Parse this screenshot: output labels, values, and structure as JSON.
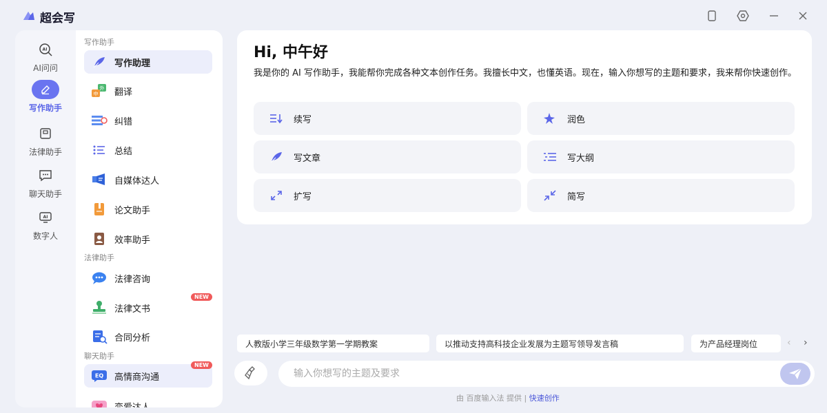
{
  "app": {
    "title": "超会写"
  },
  "rail": [
    {
      "label": "AI问问"
    },
    {
      "label": "写作助手"
    },
    {
      "label": "法律助手"
    },
    {
      "label": "聊天助手"
    },
    {
      "label": "数字人"
    }
  ],
  "menu": {
    "sections": [
      "写作助手",
      "法律助手",
      "聊天助手"
    ],
    "items": [
      {
        "label": "写作助理"
      },
      {
        "label": "翻译"
      },
      {
        "label": "纠错"
      },
      {
        "label": "总结"
      },
      {
        "label": "自媒体达人"
      },
      {
        "label": "论文助手"
      },
      {
        "label": "效率助手"
      },
      {
        "label": "法律咨询"
      },
      {
        "label": "法律文书",
        "badge": "NEW"
      },
      {
        "label": "合同分析"
      },
      {
        "label": "高情商沟通",
        "badge": "NEW"
      },
      {
        "label": "恋爱达人"
      }
    ]
  },
  "main": {
    "greeting": "Hi, 中午好",
    "intro": "我是你的 AI 写作助手，我能帮你完成各种文本创作任务。我擅长中文，也懂英语。现在，输入你想写的主题和要求，我来帮你快速创作。",
    "actions": [
      {
        "label": "续写"
      },
      {
        "label": "润色"
      },
      {
        "label": "写文章"
      },
      {
        "label": "写大纲"
      },
      {
        "label": "扩写"
      },
      {
        "label": "简写"
      }
    ]
  },
  "suggestions": [
    "人教版小学三年级数学第一学期教案",
    "以推动支持高科技企业发展为主题写领导发言稿",
    "为产品经理岗位"
  ],
  "input": {
    "placeholder": "输入你想写的主题及要求"
  },
  "footer": {
    "prefix": "由 百度输入法 提供 |",
    "link": "快速创作"
  },
  "colors": {
    "accent": "#5b66e8",
    "badge": "#f05a5a"
  }
}
